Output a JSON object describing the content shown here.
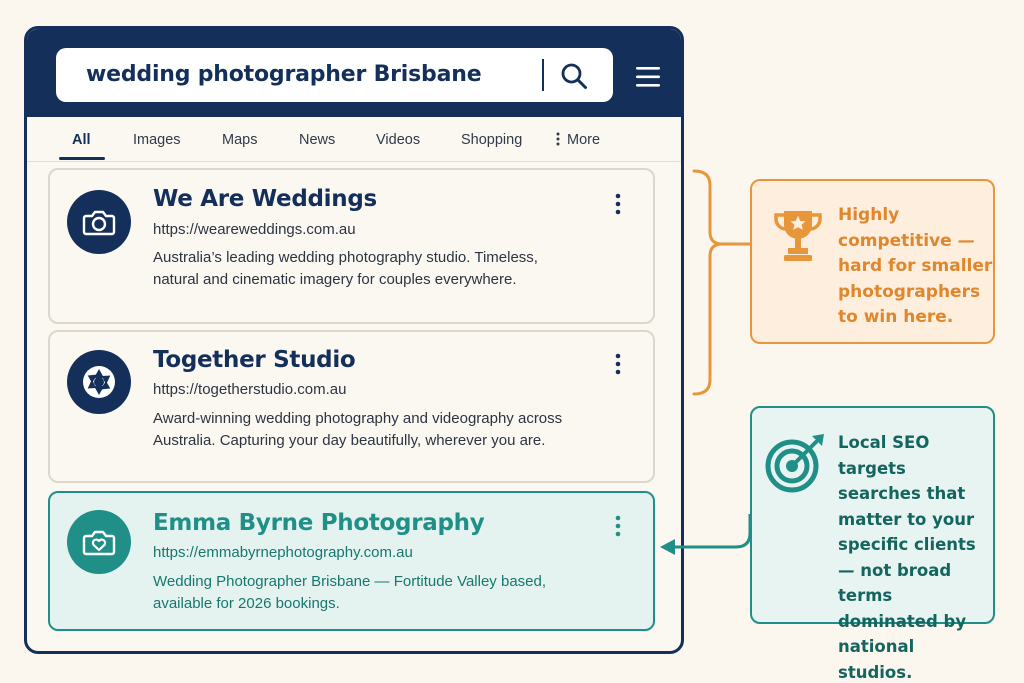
{
  "search": {
    "query": "wedding photographer Brisbane",
    "search_icon": "search-icon",
    "menu_icon": "hamburger-menu-icon"
  },
  "tabs": [
    {
      "label": "All",
      "active": true
    },
    {
      "label": "Images"
    },
    {
      "label": "Maps"
    },
    {
      "label": "News"
    },
    {
      "label": "Videos"
    },
    {
      "label": "Shopping"
    },
    {
      "label": "More",
      "icon": "vertical-dots-icon"
    }
  ],
  "results": [
    {
      "title": "We Are Weddings",
      "url": "https://weareweddings.com.au",
      "description": "Australia’s leading wedding photography studio. Timeless, natural and cinematic imagery for couples everywhere.",
      "icon": "camera-icon"
    },
    {
      "title": "Together Studio",
      "url": "https://togetherstudio.com.au",
      "description": "Award-winning wedding photography and videography across Australia. Capturing your day beautifully, wherever you are.",
      "icon": "aperture-icon"
    },
    {
      "title": "Emma Byrne Photography",
      "url": "https://emmabyrnephotography.com.au",
      "description": "Wedding Photographer Brisbane — Fortitude Valley based, available for 2026 bookings.",
      "icon": "camera-heart-icon",
      "highlighted": true
    }
  ],
  "callouts": {
    "competitive": {
      "text": "Highly competitive — hard for smaller photographers to win here.",
      "icon": "trophy-icon"
    },
    "local_seo": {
      "text": "Local SEO targets searches that matter to your specific clients — not broad terms dominated by national studios.",
      "icon": "target-icon"
    }
  },
  "colors": {
    "navy": "#14305a",
    "teal": "#1f8f87",
    "orange": "#e8963a",
    "background": "#fbf7ef"
  }
}
